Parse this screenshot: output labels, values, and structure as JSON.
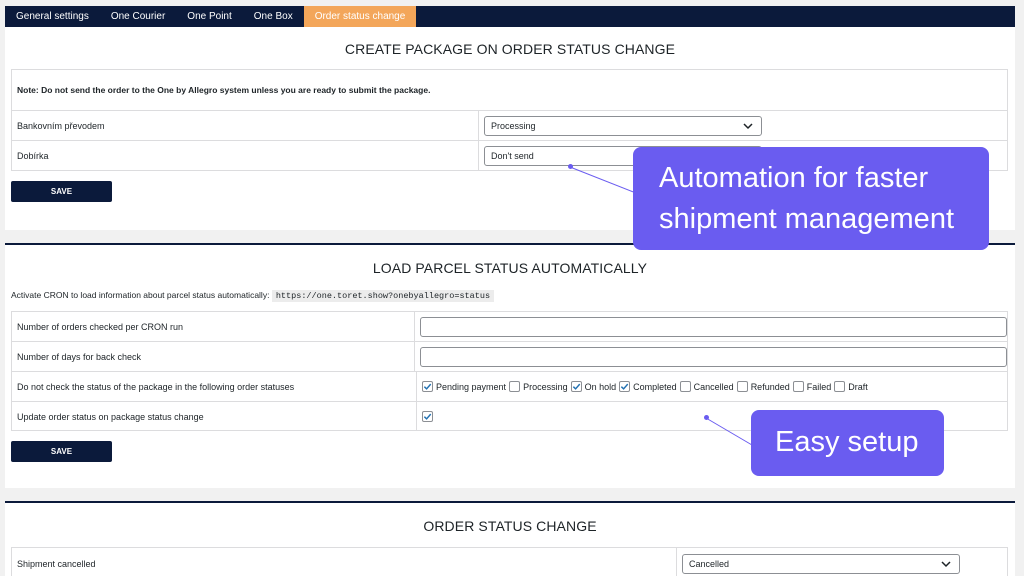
{
  "tabs": [
    {
      "label": "General settings"
    },
    {
      "label": "One Courier"
    },
    {
      "label": "One Point"
    },
    {
      "label": "One Box"
    },
    {
      "label": "Order status change"
    }
  ],
  "section1": {
    "title": "CREATE PACKAGE ON ORDER STATUS CHANGE",
    "note": "Note: Do not send the order to the One by Allegro system unless you are ready to submit the package.",
    "rows": [
      {
        "label": "Bankovním převodem",
        "value": "Processing"
      },
      {
        "label": "Dobírka",
        "value": "Don't send"
      }
    ],
    "save_label": "SAVE"
  },
  "section2": {
    "title": "LOAD PARCEL STATUS AUTOMATICALLY",
    "cron_text": "Activate CRON to load information about parcel status automatically:",
    "cron_url": "https://one.toret.show?onebyallegro=status",
    "rows": {
      "orders_per_run": "Number of orders checked per CRON run",
      "days_back": "Number of days for back check",
      "exclude_statuses": "Do not check the status of the package in the following order statuses",
      "update_status": "Update order status on package status change"
    },
    "statuses": [
      {
        "label": "Pending payment",
        "checked": true
      },
      {
        "label": "Processing",
        "checked": false
      },
      {
        "label": "On hold",
        "checked": true
      },
      {
        "label": "Completed",
        "checked": true
      },
      {
        "label": "Cancelled",
        "checked": false
      },
      {
        "label": "Refunded",
        "checked": false
      },
      {
        "label": "Failed",
        "checked": false
      },
      {
        "label": "Draft",
        "checked": false
      }
    ],
    "update_checked": true,
    "save_label": "SAVE"
  },
  "section3": {
    "title": "ORDER STATUS CHANGE",
    "rows": [
      {
        "label": "Shipment cancelled",
        "value": "Cancelled"
      }
    ]
  },
  "callouts": {
    "automation": "Automation for faster shipment management",
    "easy_setup": "Easy setup"
  },
  "colors": {
    "navy": "#0b1a3b",
    "active_tab": "#f3a65a",
    "callout": "#6a5cf0"
  }
}
